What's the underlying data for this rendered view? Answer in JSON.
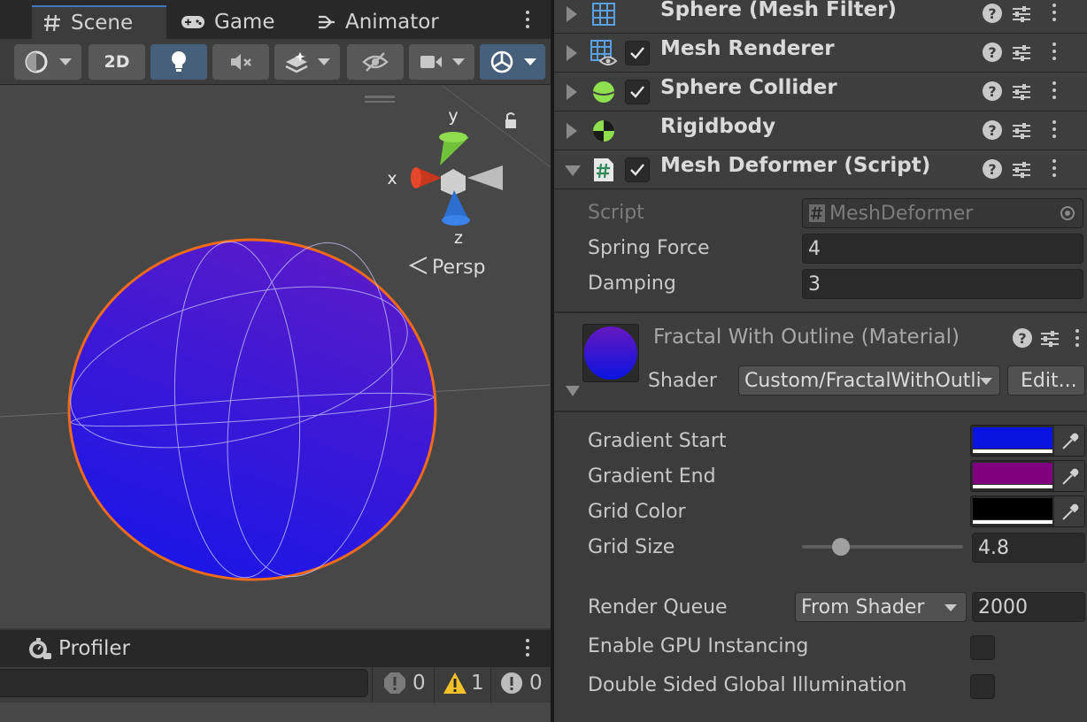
{
  "scene_window": {
    "tabs": [
      {
        "label": "Scene",
        "icon": "hash-grid-icon",
        "active": true
      },
      {
        "label": "Game",
        "icon": "gamepad-icon"
      },
      {
        "label": "Animator",
        "icon": "animator-icon"
      }
    ],
    "toolbar": {
      "mode_2d_label": "2D"
    },
    "gizmo": {
      "axis_y": "y",
      "axis_x": "x",
      "axis_z": "z",
      "projection_label": "Persp"
    },
    "colors": {
      "sphere_top": "#5a1bc8",
      "sphere_bottom": "#1a16e6",
      "outline": "#f06a1a"
    }
  },
  "console": {
    "tab_label": "Profiler",
    "error_count": "0",
    "warning_count": "1",
    "message_count": "0"
  },
  "inspector": {
    "components": [
      {
        "name": "Sphere (Mesh Filter)",
        "icon": "mesh-filter-icon",
        "has_checkbox": false
      },
      {
        "name": "Mesh Renderer",
        "icon": "mesh-renderer-icon",
        "has_checkbox": true
      },
      {
        "name": "Sphere Collider",
        "icon": "sphere-collider-icon",
        "has_checkbox": true
      },
      {
        "name": "Rigidbody",
        "icon": "rigidbody-icon",
        "has_checkbox": false
      },
      {
        "name": "Mesh Deformer (Script)",
        "icon": "script-icon",
        "has_checkbox": true,
        "expanded": true
      }
    ],
    "mesh_deformer": {
      "script_label": "Script",
      "script_value": "MeshDeformer",
      "spring_force_label": "Spring Force",
      "spring_force_value": "4",
      "damping_label": "Damping",
      "damping_value": "3"
    },
    "material": {
      "title": "Fractal With Outline (Material)",
      "shader_label": "Shader",
      "shader_value": "Custom/FractalWithOutline",
      "edit_label": "Edit...",
      "gradient_start_label": "Gradient Start",
      "gradient_start_color": "#0a14e0",
      "gradient_end_label": "Gradient End",
      "gradient_end_color": "#800080",
      "grid_color_label": "Grid Color",
      "grid_color_value": "#000000",
      "grid_size_label": "Grid Size",
      "grid_size_value": "4.8",
      "grid_size_slider_fraction": 0.24,
      "render_queue_label": "Render Queue",
      "render_queue_mode": "From Shader",
      "render_queue_value": "2000",
      "gpu_instancing_label": "Enable GPU Instancing",
      "gpu_instancing_checked": false,
      "double_sided_gi_label": "Double Sided Global Illumination",
      "double_sided_gi_checked": false
    }
  }
}
